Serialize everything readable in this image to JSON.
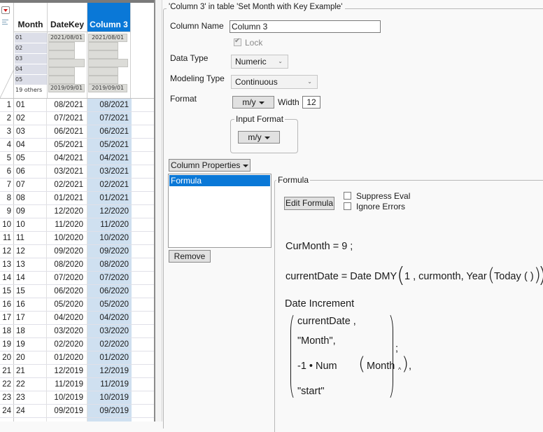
{
  "table": {
    "columns": [
      "Month",
      "DateKey",
      "Column 3"
    ],
    "selected_column": "Column 3",
    "summary": {
      "month_levels": [
        "01",
        "02",
        "03",
        "04",
        "05"
      ],
      "month_others": "19 others",
      "datekey_max": "2021/08/01",
      "datekey_min": "2019/09/01",
      "col3_max": "2021/08/01",
      "col3_min": "2019/09/01"
    },
    "rows": [
      {
        "n": "1",
        "month": "01",
        "datekey": "08/2021",
        "col3": "08/2021"
      },
      {
        "n": "2",
        "month": "02",
        "datekey": "07/2021",
        "col3": "07/2021"
      },
      {
        "n": "3",
        "month": "03",
        "datekey": "06/2021",
        "col3": "06/2021"
      },
      {
        "n": "4",
        "month": "04",
        "datekey": "05/2021",
        "col3": "05/2021"
      },
      {
        "n": "5",
        "month": "05",
        "datekey": "04/2021",
        "col3": "04/2021"
      },
      {
        "n": "6",
        "month": "06",
        "datekey": "03/2021",
        "col3": "03/2021"
      },
      {
        "n": "7",
        "month": "07",
        "datekey": "02/2021",
        "col3": "02/2021"
      },
      {
        "n": "8",
        "month": "08",
        "datekey": "01/2021",
        "col3": "01/2021"
      },
      {
        "n": "9",
        "month": "09",
        "datekey": "12/2020",
        "col3": "12/2020"
      },
      {
        "n": "10",
        "month": "10",
        "datekey": "11/2020",
        "col3": "11/2020"
      },
      {
        "n": "11",
        "month": "11",
        "datekey": "10/2020",
        "col3": "10/2020"
      },
      {
        "n": "12",
        "month": "12",
        "datekey": "09/2020",
        "col3": "09/2020"
      },
      {
        "n": "13",
        "month": "13",
        "datekey": "08/2020",
        "col3": "08/2020"
      },
      {
        "n": "14",
        "month": "14",
        "datekey": "07/2020",
        "col3": "07/2020"
      },
      {
        "n": "15",
        "month": "15",
        "datekey": "06/2020",
        "col3": "06/2020"
      },
      {
        "n": "16",
        "month": "16",
        "datekey": "05/2020",
        "col3": "05/2020"
      },
      {
        "n": "17",
        "month": "17",
        "datekey": "04/2020",
        "col3": "04/2020"
      },
      {
        "n": "18",
        "month": "18",
        "datekey": "03/2020",
        "col3": "03/2020"
      },
      {
        "n": "19",
        "month": "19",
        "datekey": "02/2020",
        "col3": "02/2020"
      },
      {
        "n": "20",
        "month": "20",
        "datekey": "01/2020",
        "col3": "01/2020"
      },
      {
        "n": "21",
        "month": "21",
        "datekey": "12/2019",
        "col3": "12/2019"
      },
      {
        "n": "22",
        "month": "22",
        "datekey": "11/2019",
        "col3": "11/2019"
      },
      {
        "n": "23",
        "month": "23",
        "datekey": "10/2019",
        "col3": "10/2019"
      },
      {
        "n": "24",
        "month": "24",
        "datekey": "09/2019",
        "col3": "09/2019"
      }
    ]
  },
  "panel": {
    "title": "'Column 3' in table 'Set Month with Key Example'",
    "column_name_label": "Column Name",
    "column_name_value": "Column 3",
    "lock_label": "Lock",
    "lock_checked": true,
    "data_type_label": "Data Type",
    "data_type_value": "Numeric",
    "modeling_type_label": "Modeling Type",
    "modeling_type_value": "Continuous",
    "format_label": "Format",
    "format_value": "m/y",
    "width_label": "Width",
    "width_value": "12",
    "input_format_label": "Input Format",
    "input_format_value": "m/y",
    "column_properties_label": "Column Properties",
    "properties_list": [
      "Formula"
    ],
    "remove_label": "Remove",
    "formula_group_label": "Formula",
    "edit_formula_label": "Edit Formula",
    "suppress_eval_label": "Suppress Eval",
    "ignore_errors_label": "Ignore Errors"
  },
  "formula": {
    "line1": "CurMonth = 9 ;",
    "line2_lhs": "currentDate = Date DMY",
    "line2_args": "1 , curmonth, Year",
    "line2_inner": "Today",
    "line2_empty": "( )",
    "line3": "Date Increment",
    "args": [
      "currentDate ,",
      "\"Month\",",
      "-1 • Num",
      "\"start\""
    ],
    "num_arg": "Month",
    "trailing_comma": ",",
    "semicolon": ";"
  }
}
